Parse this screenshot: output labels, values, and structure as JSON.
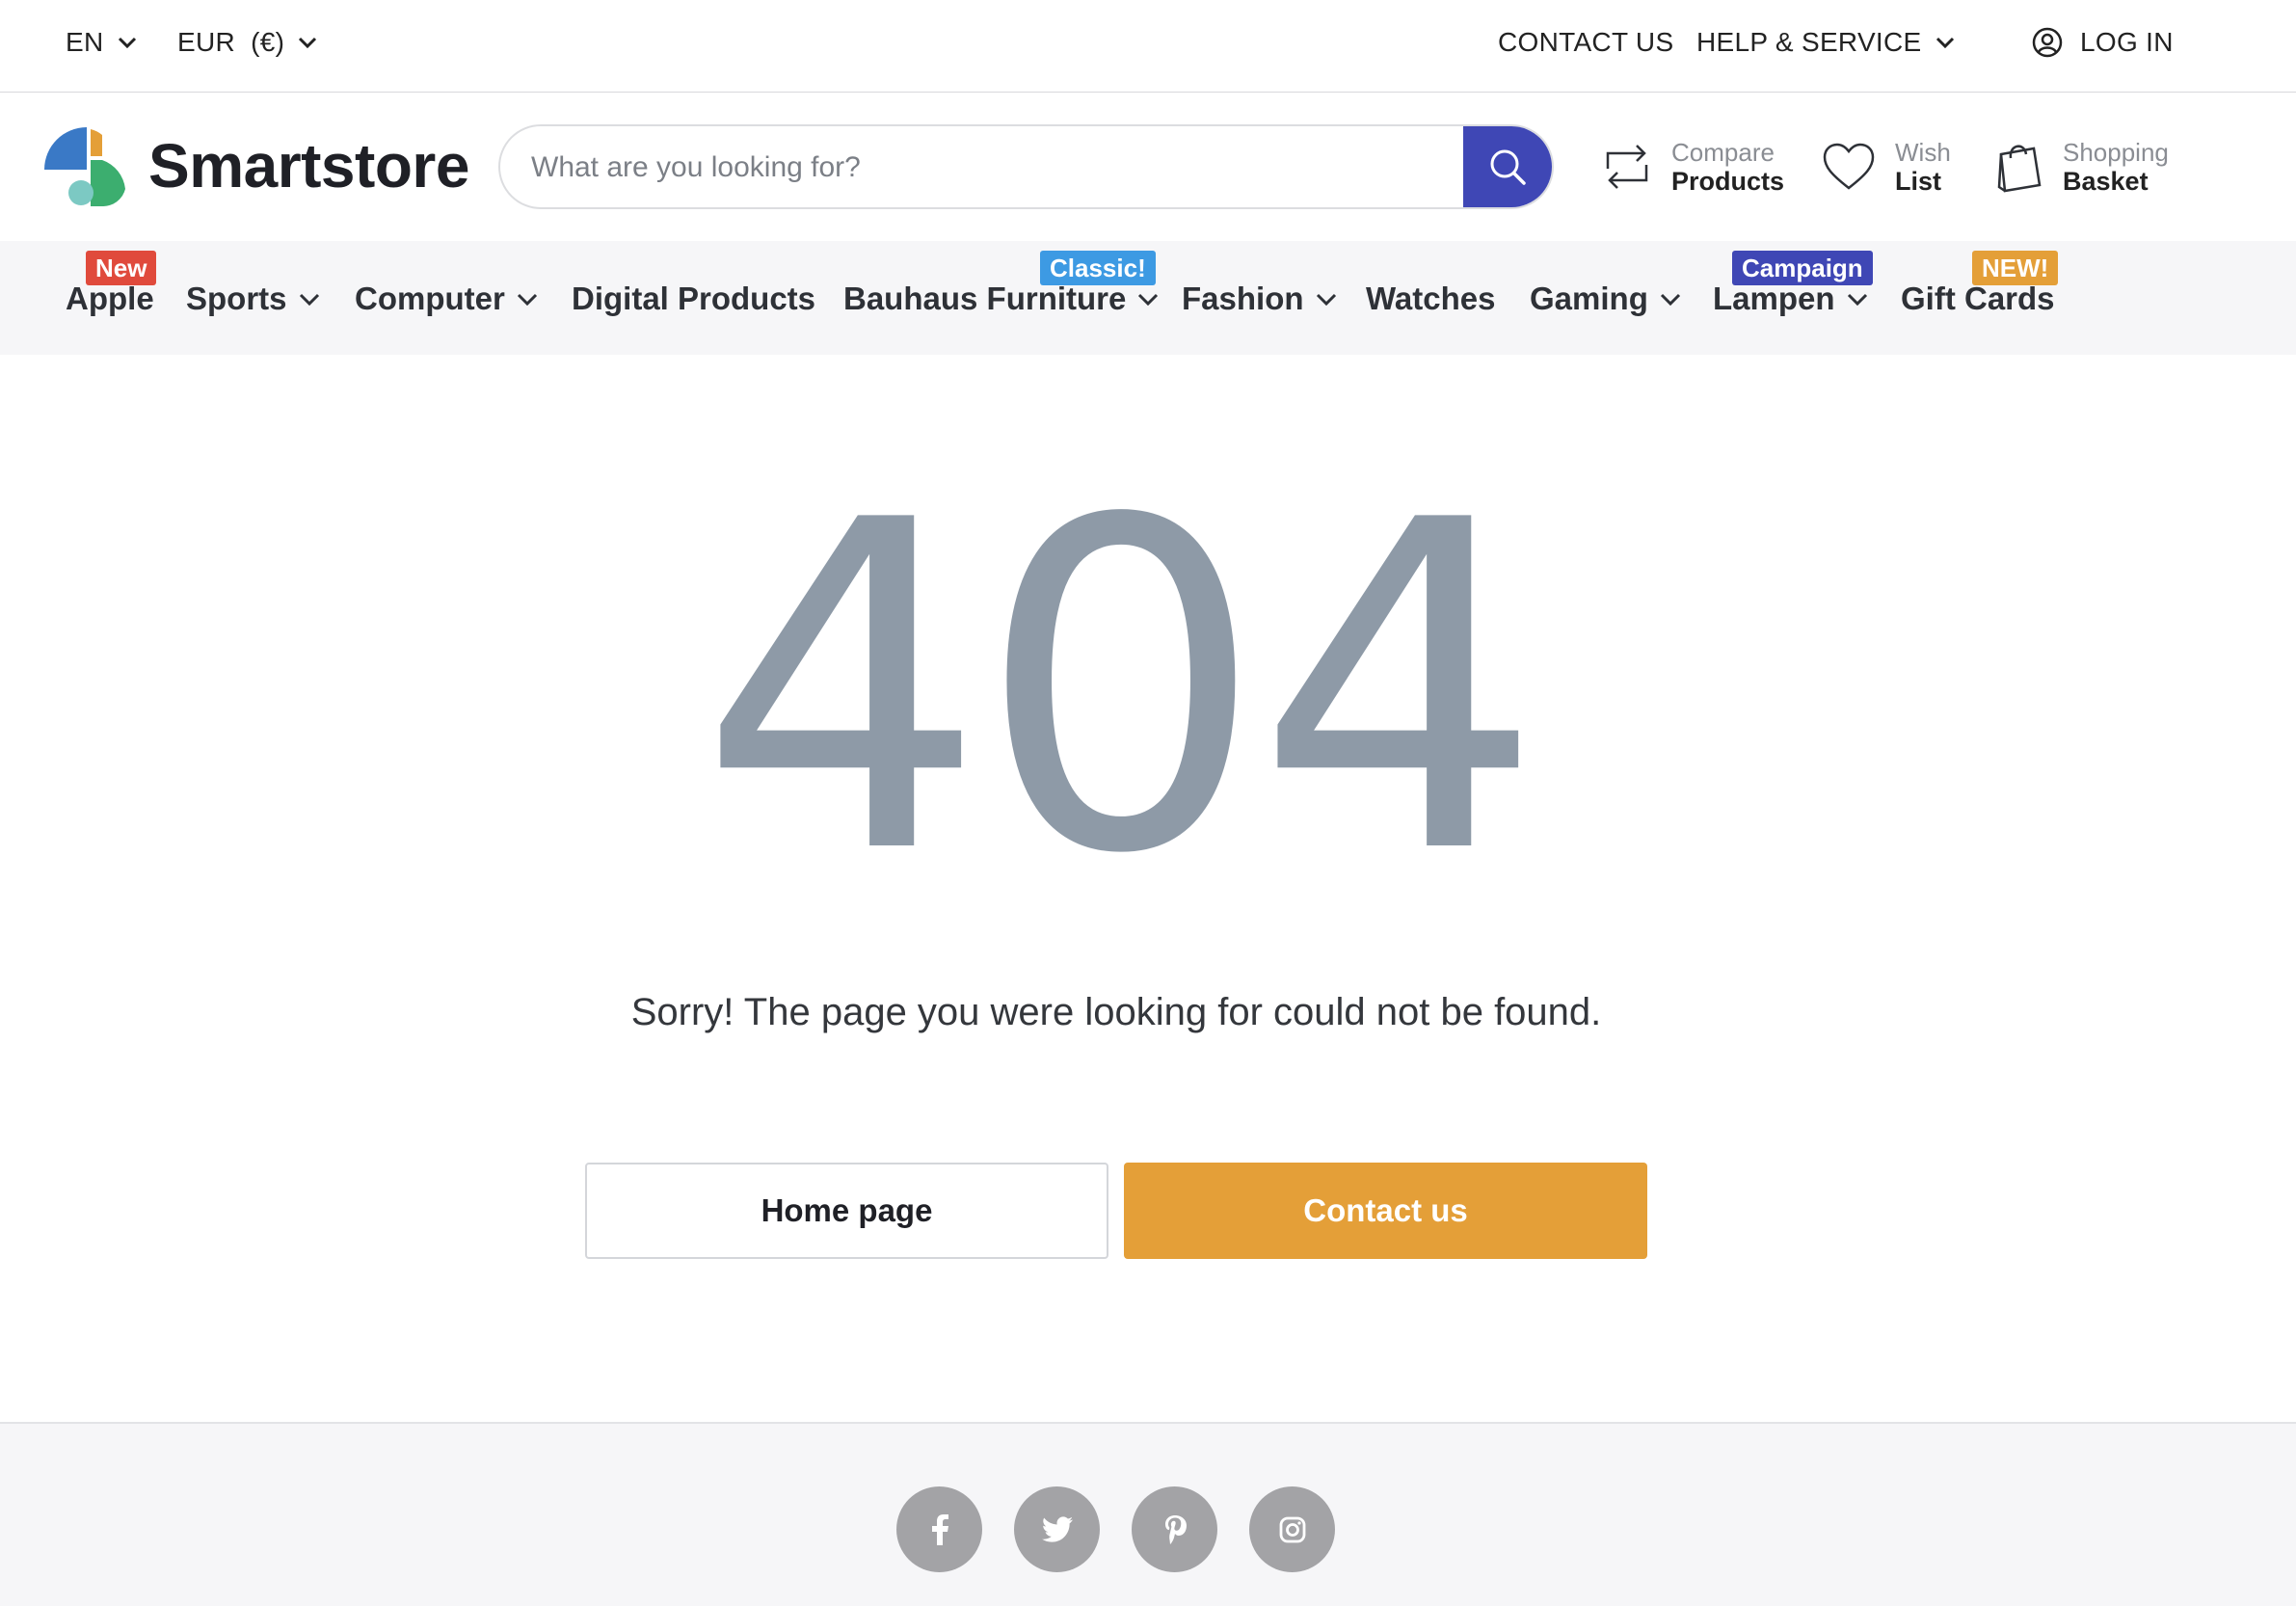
{
  "topbar": {
    "language": "EN",
    "currency": "EUR  (€)",
    "contact": "CONTACT US",
    "help": "HELP & SERVICE",
    "login": "LOG IN"
  },
  "header": {
    "brand": "Smartstore",
    "search_placeholder": "What are you looking for?",
    "compare": {
      "line1": "Compare",
      "line2": "Products"
    },
    "wishlist": {
      "line1": "Wish",
      "line2": "List"
    },
    "basket": {
      "line1": "Shopping",
      "line2": "Basket"
    }
  },
  "nav": {
    "items": [
      {
        "label": "Apple",
        "badge": "New",
        "badge_color": "#e04a3c",
        "dropdown": false
      },
      {
        "label": "Sports",
        "dropdown": true
      },
      {
        "label": "Computer",
        "dropdown": true
      },
      {
        "label": "Digital Products",
        "dropdown": false
      },
      {
        "label": "Bauhaus Furniture",
        "badge": "Classic!",
        "badge_color": "#3d9ae3",
        "dropdown": true
      },
      {
        "label": "Fashion",
        "dropdown": true
      },
      {
        "label": "Watches",
        "dropdown": false
      },
      {
        "label": "Gaming",
        "dropdown": true
      },
      {
        "label": "Lampen",
        "badge": "Campaign",
        "badge_color": "#3f47b5",
        "dropdown": true
      },
      {
        "label": "Gift Cards",
        "badge": "NEW!",
        "badge_color": "#e49f38",
        "dropdown": false
      }
    ]
  },
  "main": {
    "code": "404",
    "message": "Sorry! The page you were looking for could not be found.",
    "home_button": "Home page",
    "contact_button": "Contact us"
  },
  "footer": {
    "social": [
      "facebook-icon",
      "twitter-icon",
      "pinterest-icon",
      "instagram-icon"
    ]
  },
  "colors": {
    "primary": "#3f47b5",
    "accent": "#e49f38",
    "muted_404": "#8e9aa7"
  }
}
